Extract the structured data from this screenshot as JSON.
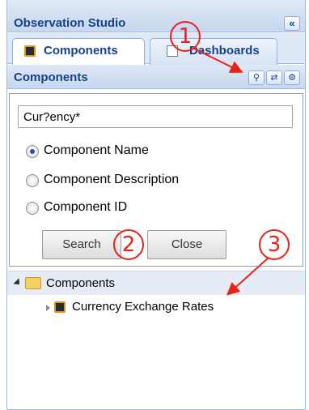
{
  "window": {
    "title": "Observation Studio",
    "collapse_glyph": "«"
  },
  "tabs": [
    {
      "label": "Components",
      "icon": "chip-icon",
      "active": true
    },
    {
      "label": "Dashboards",
      "icon": "chart-icon",
      "active": false
    }
  ],
  "subheader": {
    "title": "Components",
    "tools": [
      {
        "icon": "binoculars-icon",
        "glyph": "⚲"
      },
      {
        "icon": "refresh-icon",
        "glyph": "⇄"
      },
      {
        "icon": "settings-icon",
        "glyph": "⚙"
      }
    ]
  },
  "search": {
    "query": "Cur?ency*",
    "options": [
      {
        "label": "Component Name",
        "checked": true
      },
      {
        "label": "Component Description",
        "checked": false
      },
      {
        "label": "Component ID",
        "checked": false
      }
    ],
    "search_button": "Search",
    "close_button": "Close"
  },
  "tree": {
    "root_label": "Components",
    "items": [
      {
        "label": "Currency Exchange Rates"
      }
    ]
  },
  "annotations": {
    "a1": "1",
    "a2": "2",
    "a3": "3",
    "color": "#e8221b"
  }
}
